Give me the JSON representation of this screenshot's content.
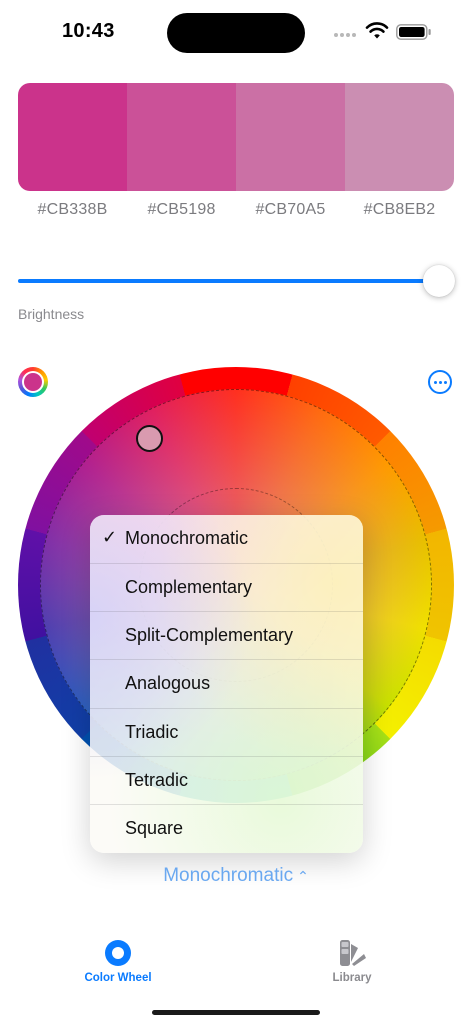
{
  "status_bar": {
    "time": "10:43",
    "icons": [
      "cellular-signal-icon",
      "wifi-icon",
      "battery-icon"
    ]
  },
  "palette": {
    "swatches": [
      {
        "hex": "#CB338B",
        "color": "#cb338b"
      },
      {
        "hex": "#CB5198",
        "color": "#cb5198"
      },
      {
        "hex": "#CB70A5",
        "color": "#cb70a5"
      },
      {
        "hex": "#CB8EB2",
        "color": "#cb8eb2"
      }
    ]
  },
  "brightness": {
    "label": "Brightness",
    "value": 1.0
  },
  "wheel": {
    "selected_color": "#cb338b",
    "handle_color": "#d99aaf"
  },
  "scheme_menu": {
    "selected": "Monochromatic",
    "options": [
      {
        "label": "Monochromatic",
        "checked": true
      },
      {
        "label": "Complementary",
        "checked": false
      },
      {
        "label": "Split-Complementary",
        "checked": false
      },
      {
        "label": "Analogous",
        "checked": false
      },
      {
        "label": "Triadic",
        "checked": false
      },
      {
        "label": "Tetradic",
        "checked": false
      },
      {
        "label": "Square",
        "checked": false
      }
    ],
    "check_glyph": "✓"
  },
  "scheme_picker": {
    "label": "Monochromatic",
    "chevron": "⌃⌄"
  },
  "tab_bar": {
    "tabs": [
      {
        "label": "Color Wheel",
        "icon": "color-wheel-icon",
        "active": true
      },
      {
        "label": "Library",
        "icon": "swatch-library-icon",
        "active": false
      }
    ]
  },
  "colors": {
    "accent": "#0a7bff",
    "secondary_text": "#7b7b7f"
  }
}
